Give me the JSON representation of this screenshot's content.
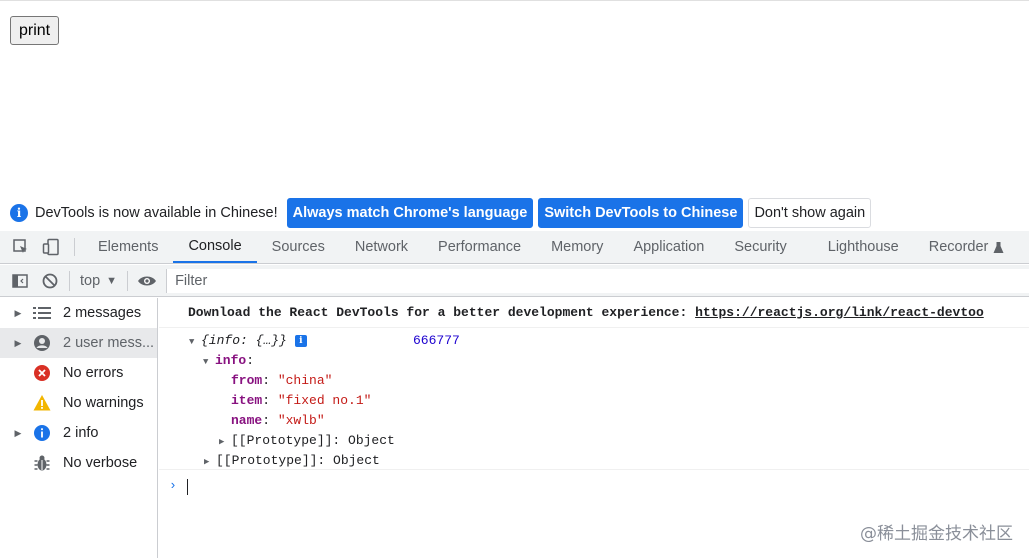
{
  "page": {
    "print_label": "print"
  },
  "infobar": {
    "message": "DevTools is now available in Chinese!",
    "btn_match": "Always match Chrome's language",
    "btn_switch": "Switch DevTools to Chinese",
    "btn_dismiss": "Don't show again"
  },
  "tabs": [
    {
      "label": "Elements"
    },
    {
      "label": "Console"
    },
    {
      "label": "Sources"
    },
    {
      "label": "Network"
    },
    {
      "label": "Performance"
    },
    {
      "label": "Memory"
    },
    {
      "label": "Application"
    },
    {
      "label": "Security"
    },
    {
      "label": "Lighthouse"
    },
    {
      "label": "Recorder"
    }
  ],
  "active_tab": "Console",
  "toolbar": {
    "context": "top",
    "filter_placeholder": "Filter"
  },
  "sidebar": {
    "items": [
      {
        "label": "2 messages",
        "icon": "list-icon"
      },
      {
        "label": "2 user mess...",
        "icon": "user-icon"
      },
      {
        "label": "No errors",
        "icon": "error-icon"
      },
      {
        "label": "No warnings",
        "icon": "warning-icon"
      },
      {
        "label": "2 info",
        "icon": "info-icon"
      },
      {
        "label": "No verbose",
        "icon": "bug-icon"
      }
    ]
  },
  "console": {
    "msg1_text": "Download the React DevTools for a better development experience: ",
    "msg1_link": "https://reactjs.org/link/react-devtoo",
    "obj_summary": "{info: {…}}",
    "obj_value": "666777",
    "info_key": "info",
    "props": [
      {
        "key": "from",
        "value": "\"china\""
      },
      {
        "key": "item",
        "value": "\"fixed no.1\""
      },
      {
        "key": "name",
        "value": "\"xwlb\""
      }
    ],
    "proto_inner": "[[Prototype]]: Object",
    "proto_outer": "[[Prototype]]: Object",
    "prompt": "›"
  },
  "watermark": "@稀土掘金技术社区",
  "colors": {
    "accent": "#1a73e8",
    "key": "#881280",
    "string": "#c41a16",
    "number": "#1c00cf"
  }
}
